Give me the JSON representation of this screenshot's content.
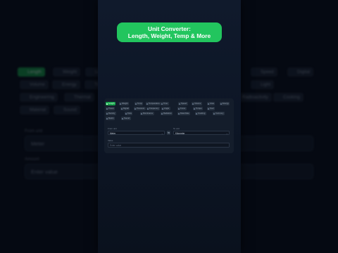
{
  "title": {
    "line1": "Unit Converter:",
    "line2": "Length, Weight, Temp & More"
  },
  "categories": [
    {
      "label": "Length",
      "icon": "ruler-icon",
      "active": true
    },
    {
      "label": "Weight",
      "icon": "scale-icon"
    },
    {
      "label": "Temp",
      "icon": "thermometer-icon"
    },
    {
      "label": "Temperature",
      "icon": "thermometer-icon"
    },
    {
      "label": "Time",
      "icon": "clock-icon"
    },
    {
      "label": "Speed",
      "icon": "gauge-icon"
    },
    {
      "label": "Volume",
      "icon": "cube-icon"
    },
    {
      "label": "Area",
      "icon": "square-icon"
    },
    {
      "label": "Energy",
      "icon": "bolt-icon"
    },
    {
      "label": "Power",
      "icon": "plug-icon"
    },
    {
      "label": "Digital",
      "icon": "chip-icon"
    },
    {
      "label": "Pressure",
      "icon": "gauge-icon"
    },
    {
      "label": "Frequency",
      "icon": "wave-icon"
    },
    {
      "label": "Angle",
      "icon": "angle-icon"
    },
    {
      "label": "Force",
      "icon": "arrow-icon"
    },
    {
      "label": "Torque",
      "icon": "wrench-icon"
    },
    {
      "label": "Fuel",
      "icon": "fuel-icon"
    },
    {
      "label": "Density",
      "icon": "drop-icon"
    },
    {
      "label": "Flow",
      "icon": "flow-icon"
    },
    {
      "label": "Illuminance",
      "icon": "bulb-icon"
    },
    {
      "label": "Radiation",
      "icon": "radiation-icon"
    },
    {
      "label": "Data Rate",
      "icon": "signal-icon"
    },
    {
      "label": "Cooking",
      "icon": "pot-icon"
    },
    {
      "label": "Currency",
      "icon": "coin-icon"
    },
    {
      "label": "Metric",
      "icon": "grid-icon"
    },
    {
      "label": "Sound",
      "icon": "speaker-icon"
    }
  ],
  "form": {
    "from_label": "From unit",
    "from_value": "Meter",
    "to_label": "To unit",
    "to_value": "Kilometer",
    "swap_symbol": "⇆",
    "chevron": "⌄",
    "value_label": "Value",
    "value_placeholder": "Enter value"
  },
  "background": {
    "chips": [
      "Length",
      "Weight",
      "Length",
      "Speed",
      "Digital",
      "Volume",
      "Energy",
      "Time",
      "Light",
      "Engineering",
      "Thermal",
      "Radioactivity",
      "Cooking",
      "Material",
      "Sound"
    ],
    "from_label": "From unit",
    "from_value": "Meter",
    "value_label": "Amount",
    "value_placeholder": "Enter value"
  },
  "colors": {
    "accent": "#22c55e",
    "chip_active": "#16a34a",
    "card": "#141d2b",
    "page": "#070b14"
  }
}
